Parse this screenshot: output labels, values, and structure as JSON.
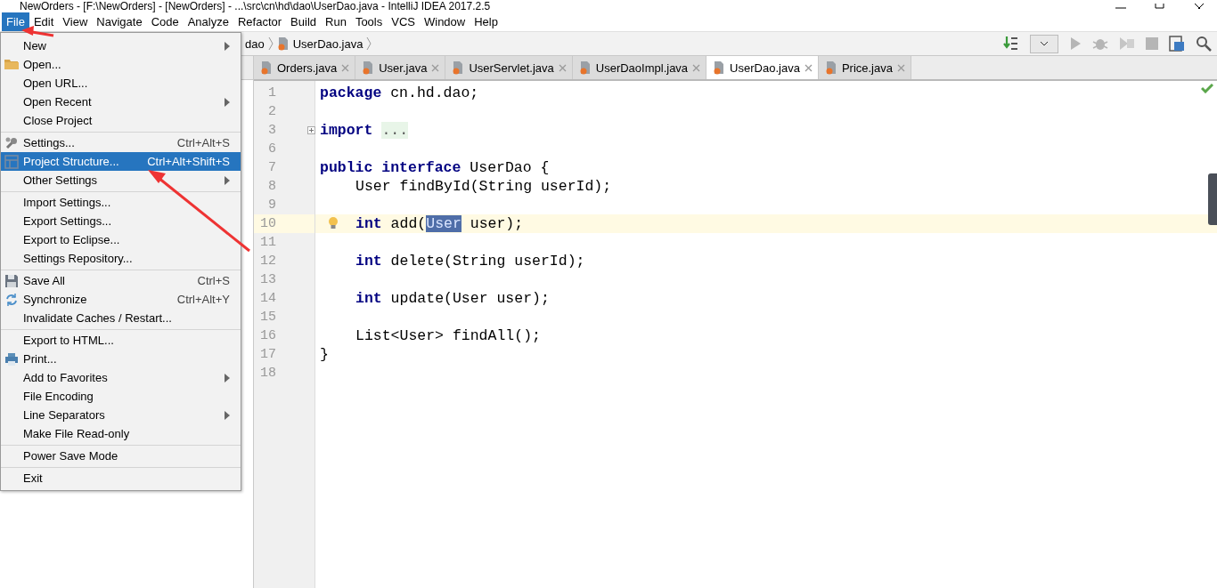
{
  "window": {
    "title": "NewOrders - [F:\\NewOrders] - [NewOrders] - ...\\src\\cn\\hd\\dao\\UserDao.java - IntelliJ IDEA 2017.2.5"
  },
  "menubar": [
    {
      "label": "File",
      "selected": true
    },
    {
      "label": "Edit",
      "selected": false
    },
    {
      "label": "View",
      "selected": false
    },
    {
      "label": "Navigate",
      "selected": false
    },
    {
      "label": "Code",
      "selected": false
    },
    {
      "label": "Analyze",
      "selected": false
    },
    {
      "label": "Refactor",
      "selected": false
    },
    {
      "label": "Build",
      "selected": false
    },
    {
      "label": "Run",
      "selected": false
    },
    {
      "label": "Tools",
      "selected": false
    },
    {
      "label": "VCS",
      "selected": false
    },
    {
      "label": "Window",
      "selected": false
    },
    {
      "label": "Help",
      "selected": false
    }
  ],
  "breadcrumbs": [
    "dao",
    "UserDao.java"
  ],
  "tabs": [
    {
      "label": "Orders.java",
      "selected": false
    },
    {
      "label": "User.java",
      "selected": false
    },
    {
      "label": "UserServlet.java",
      "selected": false
    },
    {
      "label": "UserDaoImpl.java",
      "selected": false
    },
    {
      "label": "UserDao.java",
      "selected": true
    },
    {
      "label": "Price.java",
      "selected": false
    }
  ],
  "file_menu": [
    [
      {
        "label": "New",
        "submenu": true,
        "selected": false
      },
      {
        "label": "Open...",
        "kind": "folder",
        "submenu": false,
        "selected": false
      },
      {
        "label": "Open URL...",
        "submenu": false,
        "selected": false
      },
      {
        "label": "Open Recent",
        "submenu": true,
        "selected": false
      },
      {
        "label": "Close Project",
        "submenu": false,
        "selected": false
      }
    ],
    [
      {
        "label": "Settings...",
        "kind": "wrench",
        "shortcut": "Ctrl+Alt+S",
        "submenu": false,
        "selected": false
      },
      {
        "label": "Project Structure...",
        "kind": "structure",
        "shortcut": "Ctrl+Alt+Shift+S",
        "submenu": false,
        "selected": true
      },
      {
        "label": "Other Settings",
        "submenu": true,
        "selected": false
      }
    ],
    [
      {
        "label": "Import Settings...",
        "submenu": false,
        "selected": false
      },
      {
        "label": "Export Settings...",
        "submenu": false,
        "selected": false
      },
      {
        "label": "Export to Eclipse...",
        "submenu": false,
        "selected": false
      },
      {
        "label": "Settings Repository...",
        "submenu": false,
        "selected": false
      }
    ],
    [
      {
        "label": "Save All",
        "kind": "floppy",
        "shortcut": "Ctrl+S",
        "submenu": false,
        "selected": false
      },
      {
        "label": "Synchronize",
        "kind": "sync",
        "shortcut": "Ctrl+Alt+Y",
        "submenu": false,
        "selected": false
      },
      {
        "label": "Invalidate Caches / Restart...",
        "submenu": false,
        "selected": false
      }
    ],
    [
      {
        "label": "Export to HTML...",
        "submenu": false,
        "selected": false
      },
      {
        "label": "Print...",
        "kind": "printer",
        "submenu": false,
        "selected": false
      },
      {
        "label": "Add to Favorites",
        "submenu": true,
        "selected": false
      },
      {
        "label": "File Encoding",
        "submenu": false,
        "selected": false
      },
      {
        "label": "Line Separators",
        "submenu": true,
        "selected": false
      },
      {
        "label": "Make File Read-only",
        "submenu": false,
        "selected": false
      }
    ],
    [
      {
        "label": "Power Save Mode",
        "submenu": false,
        "selected": false
      }
    ],
    [
      {
        "label": "Exit",
        "submenu": false,
        "selected": false
      }
    ]
  ],
  "code_lines": [
    {
      "number": "1",
      "current": false,
      "tokens": [
        {
          "kind": "keyword",
          "text": "package"
        },
        {
          "kind": "plain",
          "text": " cn.hd.dao;"
        }
      ]
    },
    {
      "number": "2",
      "current": false
    },
    {
      "number": "3",
      "current": false,
      "folded": true,
      "tokens": [
        {
          "kind": "keyword",
          "text": "import"
        },
        {
          "kind": "folded",
          "text": "..."
        }
      ]
    },
    {
      "number": "6",
      "current": false
    },
    {
      "number": "7",
      "current": false,
      "tokens": [
        {
          "kind": "keyword",
          "text": "public interface"
        },
        {
          "kind": "plain",
          "text": " UserDao {"
        }
      ],
      "children": [
        {
          "number": "8",
          "current": false,
          "tokens": [
            {
              "kind": "plain",
              "text": "User findById(String userId);"
            }
          ]
        },
        {
          "number": "9",
          "current": false
        },
        {
          "number": "10",
          "current": true,
          "tokens": [
            {
              "kind": "keyword",
              "text": "int"
            },
            {
              "kind": "plain",
              "text": " add("
            },
            {
              "kind": "selected",
              "text": "User"
            },
            {
              "kind": "plain",
              "text": " user);"
            }
          ]
        },
        {
          "number": "11",
          "current": false
        },
        {
          "number": "12",
          "current": false,
          "tokens": [
            {
              "kind": "keyword",
              "text": "int"
            },
            {
              "kind": "plain",
              "text": " delete(String userId);"
            }
          ]
        },
        {
          "number": "13",
          "current": false
        },
        {
          "number": "14",
          "current": false,
          "tokens": [
            {
              "kind": "keyword",
              "text": "int"
            },
            {
              "kind": "plain",
              "text": " update(User user);"
            }
          ]
        },
        {
          "number": "15",
          "current": false
        },
        {
          "number": "16",
          "current": false,
          "tokens": [
            {
              "kind": "plain",
              "text": "List<User> findAll();"
            }
          ]
        }
      ]
    },
    {
      "number": "17",
      "current": false,
      "tokens": [
        {
          "kind": "plain",
          "text": "}"
        }
      ]
    },
    {
      "number": "18",
      "current": false
    }
  ]
}
